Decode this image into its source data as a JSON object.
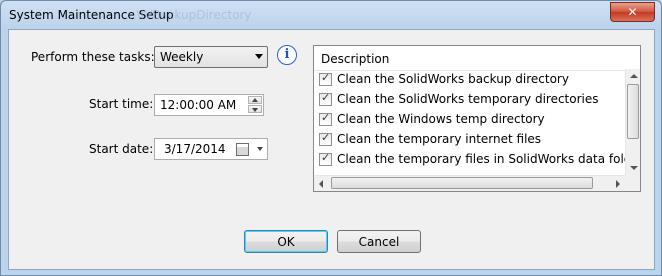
{
  "window": {
    "title": "System Maintenance Setup",
    "title_ghost": "...\\IVBackupDirectory"
  },
  "form": {
    "tasks_label": "Perform these tasks:",
    "tasks_value": "Weekly",
    "start_time_label": "Start time:",
    "start_time_value": "12:00:00 AM",
    "start_date_label": "Start date:",
    "start_date_value": "3/17/2014"
  },
  "task_list": {
    "header": "Description",
    "items": [
      {
        "label": "Clean the SolidWorks backup directory",
        "checked": true
      },
      {
        "label": "Clean the SolidWorks temporary directories",
        "checked": true
      },
      {
        "label": "Clean the Windows temp directory",
        "checked": true
      },
      {
        "label": "Clean the temporary internet files",
        "checked": true
      },
      {
        "label": "Clean the temporary files in SolidWorks data folde",
        "checked": true
      }
    ]
  },
  "buttons": {
    "ok": "OK",
    "cancel": "Cancel"
  },
  "icons": {
    "close": "close-icon",
    "info": "info-icon",
    "calendar": "calendar-icon"
  },
  "colors": {
    "frame": "#bcd3ec",
    "client": "#f0f0f0",
    "close_button": "#c23a22",
    "default_button_border": "#3c7fb1"
  }
}
